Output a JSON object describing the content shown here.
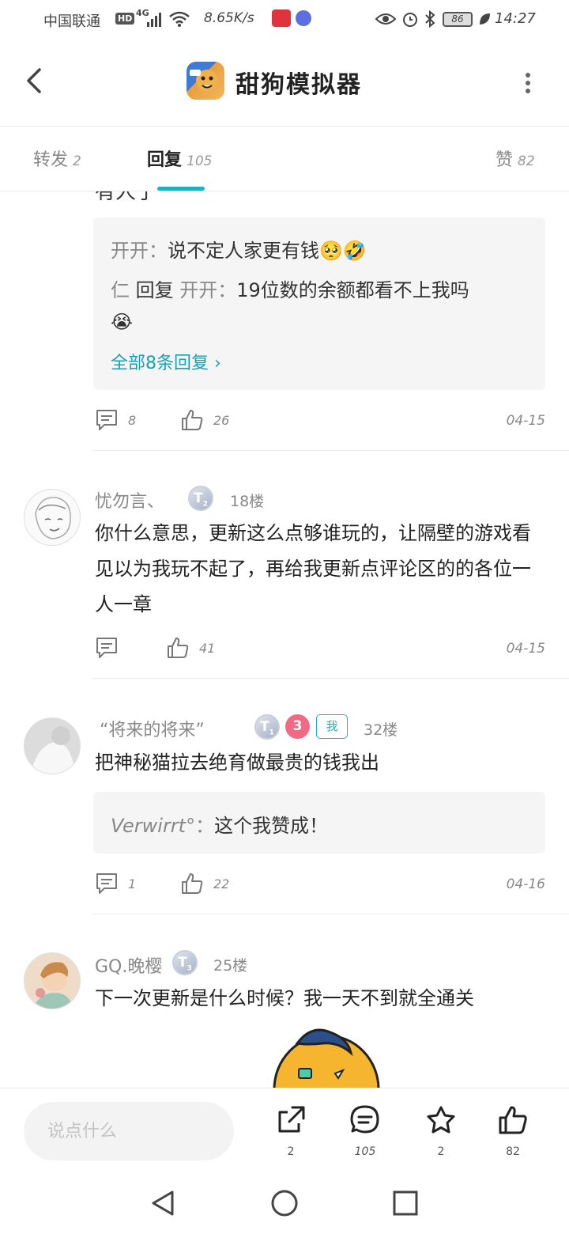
{
  "status_bar": {
    "carrier": "中国联通",
    "hd": "HD",
    "network": "4G",
    "speed": "8.65K/s",
    "battery": "86",
    "time": "14:27"
  },
  "header": {
    "title": "甜狗模拟器"
  },
  "tabs": [
    {
      "label": "转发",
      "count": "2"
    },
    {
      "label": "回复",
      "count": "105"
    },
    {
      "label": "赞",
      "count": "82"
    }
  ],
  "thread0": {
    "partial_text": "有人了",
    "replies": [
      {
        "name": "开开",
        "sep": "：",
        "text": "说不定人家更有钱🥺🤣"
      },
      {
        "name": "仁",
        "mid": " 回复 ",
        "target": "开开",
        "sep": "：",
        "text": "19位数的余额都看不上我吗"
      },
      {
        "text": "😭"
      }
    ],
    "see_all": "全部8条回复 ›",
    "comment_count": "8",
    "like_count": "26",
    "date": "04-15"
  },
  "comments": [
    {
      "author": "忧勿言、",
      "badge": "T",
      "badge_sub": "2",
      "floor": "18楼",
      "text": "你什么意思，更新这么点够谁玩的，让隔壁的游戏看见以为我玩不起了，再给我更新点评论区的的各位一人一章",
      "comment_count": "",
      "like_count": "41",
      "date": "04-15"
    },
    {
      "author": "“将来的将来”",
      "badge": "T",
      "badge_sub": "1",
      "badge2": "3",
      "me_tag": "我",
      "floor": "32楼",
      "text": "把神秘猫拉去绝育做最贵的钱我出",
      "reply": {
        "name": "Verwirrt°",
        "sep": "：",
        "text": "这个我赞成！"
      },
      "comment_count": "1",
      "like_count": "22",
      "date": "04-16"
    },
    {
      "author": "GQ.晚樱",
      "badge": "T",
      "badge_sub": "3",
      "floor": "25楼",
      "text": "下一次更新是什么时候？我一天不到就全通关"
    }
  ],
  "bottom_bar": {
    "placeholder": "说点什么",
    "share_count": "2",
    "comment_count": "105",
    "favorite_count": "2",
    "like_count": "82"
  },
  "colors": {
    "accent": "#18b4c0",
    "link": "#18a2b0"
  }
}
